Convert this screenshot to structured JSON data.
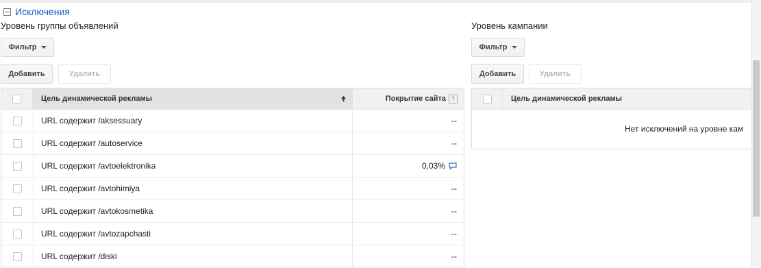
{
  "section": {
    "title": "Исключения"
  },
  "left": {
    "label": "Уровень группы объявлений",
    "filter_label": "Фильтр",
    "add_label": "Добавить",
    "delete_label": "Удалить",
    "columns": {
      "target": "Цель динамической рекламы",
      "coverage": "Покрытие сайта",
      "help": "?"
    },
    "rows": [
      {
        "target": "URL содержит /aksessuary",
        "coverage": "--"
      },
      {
        "target": "URL содержит /autoservice",
        "coverage": "--"
      },
      {
        "target": "URL содержит /avtoelektronika",
        "coverage": "0,03%"
      },
      {
        "target": "URL содержит /avtohimiya",
        "coverage": "--"
      },
      {
        "target": "URL содержит /avtokosmetika",
        "coverage": "--"
      },
      {
        "target": "URL содержит /avtozapchasti",
        "coverage": "--"
      },
      {
        "target": "URL содержит /diski",
        "coverage": "--"
      }
    ]
  },
  "right": {
    "label": "Уровень кампании",
    "filter_label": "Фильтр",
    "add_label": "Добавить",
    "delete_label": "Удалить",
    "columns": {
      "target": "Цель динамической рекламы"
    },
    "empty_message": "Нет исключений на уровне кам"
  },
  "icons": {
    "collapse": "minus-box-icon",
    "dropdown": "caret-down-icon",
    "sort": "arrow-up-icon",
    "help": "question-icon",
    "comment": "speech-bubble-icon"
  },
  "colors": {
    "link": "#1155cc",
    "header_bg": "#f1f1f1",
    "comment_icon": "#3d6fb8"
  }
}
